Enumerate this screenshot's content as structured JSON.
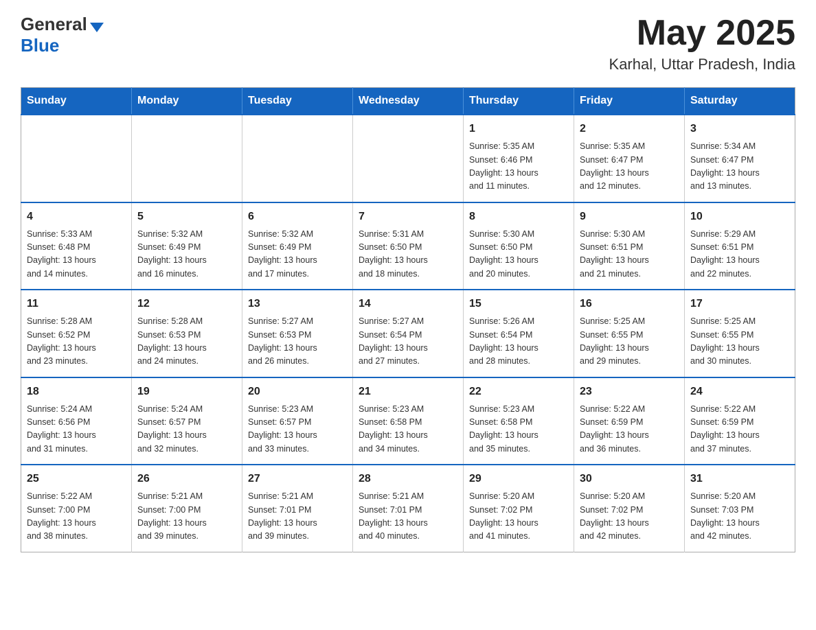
{
  "header": {
    "logo_general": "General",
    "logo_blue": "Blue",
    "month": "May 2025",
    "location": "Karhal, Uttar Pradesh, India"
  },
  "weekdays": [
    "Sunday",
    "Monday",
    "Tuesday",
    "Wednesday",
    "Thursday",
    "Friday",
    "Saturday"
  ],
  "weeks": [
    [
      {
        "day": "",
        "info": ""
      },
      {
        "day": "",
        "info": ""
      },
      {
        "day": "",
        "info": ""
      },
      {
        "day": "",
        "info": ""
      },
      {
        "day": "1",
        "info": "Sunrise: 5:35 AM\nSunset: 6:46 PM\nDaylight: 13 hours\nand 11 minutes."
      },
      {
        "day": "2",
        "info": "Sunrise: 5:35 AM\nSunset: 6:47 PM\nDaylight: 13 hours\nand 12 minutes."
      },
      {
        "day": "3",
        "info": "Sunrise: 5:34 AM\nSunset: 6:47 PM\nDaylight: 13 hours\nand 13 minutes."
      }
    ],
    [
      {
        "day": "4",
        "info": "Sunrise: 5:33 AM\nSunset: 6:48 PM\nDaylight: 13 hours\nand 14 minutes."
      },
      {
        "day": "5",
        "info": "Sunrise: 5:32 AM\nSunset: 6:49 PM\nDaylight: 13 hours\nand 16 minutes."
      },
      {
        "day": "6",
        "info": "Sunrise: 5:32 AM\nSunset: 6:49 PM\nDaylight: 13 hours\nand 17 minutes."
      },
      {
        "day": "7",
        "info": "Sunrise: 5:31 AM\nSunset: 6:50 PM\nDaylight: 13 hours\nand 18 minutes."
      },
      {
        "day": "8",
        "info": "Sunrise: 5:30 AM\nSunset: 6:50 PM\nDaylight: 13 hours\nand 20 minutes."
      },
      {
        "day": "9",
        "info": "Sunrise: 5:30 AM\nSunset: 6:51 PM\nDaylight: 13 hours\nand 21 minutes."
      },
      {
        "day": "10",
        "info": "Sunrise: 5:29 AM\nSunset: 6:51 PM\nDaylight: 13 hours\nand 22 minutes."
      }
    ],
    [
      {
        "day": "11",
        "info": "Sunrise: 5:28 AM\nSunset: 6:52 PM\nDaylight: 13 hours\nand 23 minutes."
      },
      {
        "day": "12",
        "info": "Sunrise: 5:28 AM\nSunset: 6:53 PM\nDaylight: 13 hours\nand 24 minutes."
      },
      {
        "day": "13",
        "info": "Sunrise: 5:27 AM\nSunset: 6:53 PM\nDaylight: 13 hours\nand 26 minutes."
      },
      {
        "day": "14",
        "info": "Sunrise: 5:27 AM\nSunset: 6:54 PM\nDaylight: 13 hours\nand 27 minutes."
      },
      {
        "day": "15",
        "info": "Sunrise: 5:26 AM\nSunset: 6:54 PM\nDaylight: 13 hours\nand 28 minutes."
      },
      {
        "day": "16",
        "info": "Sunrise: 5:25 AM\nSunset: 6:55 PM\nDaylight: 13 hours\nand 29 minutes."
      },
      {
        "day": "17",
        "info": "Sunrise: 5:25 AM\nSunset: 6:55 PM\nDaylight: 13 hours\nand 30 minutes."
      }
    ],
    [
      {
        "day": "18",
        "info": "Sunrise: 5:24 AM\nSunset: 6:56 PM\nDaylight: 13 hours\nand 31 minutes."
      },
      {
        "day": "19",
        "info": "Sunrise: 5:24 AM\nSunset: 6:57 PM\nDaylight: 13 hours\nand 32 minutes."
      },
      {
        "day": "20",
        "info": "Sunrise: 5:23 AM\nSunset: 6:57 PM\nDaylight: 13 hours\nand 33 minutes."
      },
      {
        "day": "21",
        "info": "Sunrise: 5:23 AM\nSunset: 6:58 PM\nDaylight: 13 hours\nand 34 minutes."
      },
      {
        "day": "22",
        "info": "Sunrise: 5:23 AM\nSunset: 6:58 PM\nDaylight: 13 hours\nand 35 minutes."
      },
      {
        "day": "23",
        "info": "Sunrise: 5:22 AM\nSunset: 6:59 PM\nDaylight: 13 hours\nand 36 minutes."
      },
      {
        "day": "24",
        "info": "Sunrise: 5:22 AM\nSunset: 6:59 PM\nDaylight: 13 hours\nand 37 minutes."
      }
    ],
    [
      {
        "day": "25",
        "info": "Sunrise: 5:22 AM\nSunset: 7:00 PM\nDaylight: 13 hours\nand 38 minutes."
      },
      {
        "day": "26",
        "info": "Sunrise: 5:21 AM\nSunset: 7:00 PM\nDaylight: 13 hours\nand 39 minutes."
      },
      {
        "day": "27",
        "info": "Sunrise: 5:21 AM\nSunset: 7:01 PM\nDaylight: 13 hours\nand 39 minutes."
      },
      {
        "day": "28",
        "info": "Sunrise: 5:21 AM\nSunset: 7:01 PM\nDaylight: 13 hours\nand 40 minutes."
      },
      {
        "day": "29",
        "info": "Sunrise: 5:20 AM\nSunset: 7:02 PM\nDaylight: 13 hours\nand 41 minutes."
      },
      {
        "day": "30",
        "info": "Sunrise: 5:20 AM\nSunset: 7:02 PM\nDaylight: 13 hours\nand 42 minutes."
      },
      {
        "day": "31",
        "info": "Sunrise: 5:20 AM\nSunset: 7:03 PM\nDaylight: 13 hours\nand 42 minutes."
      }
    ]
  ]
}
